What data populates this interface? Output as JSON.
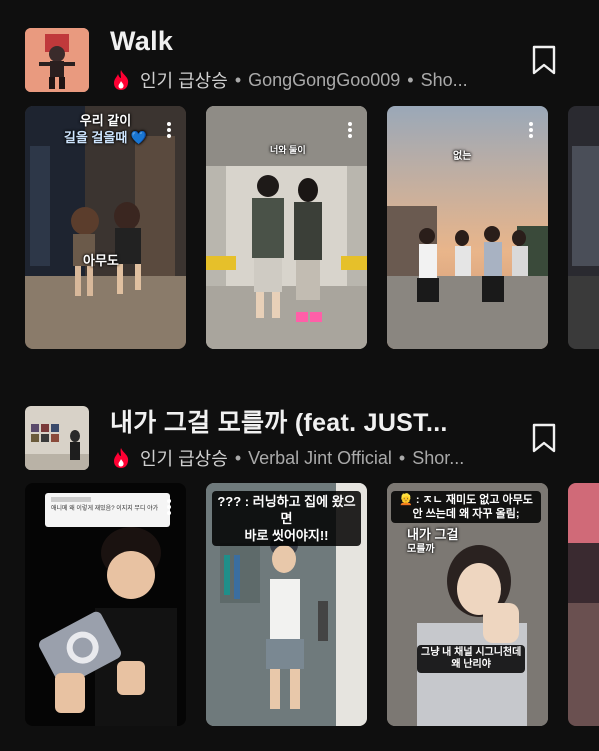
{
  "sections": [
    {
      "title": "Walk",
      "meta": {
        "trend_label": "인기 급상승",
        "channel": "GongGongGoo009",
        "more": "Sho..."
      },
      "cards": [
        {
          "caption_line1": "우리 같이",
          "caption_line2": "길을 걸을때 💙",
          "caption_bottom": "아무도"
        },
        {
          "caption": "너와 둘이"
        },
        {
          "caption": "없는"
        },
        {
          "caption": ""
        }
      ]
    },
    {
      "title": "내가 그걸 모를까 (feat. JUST...",
      "meta": {
        "trend_label": "인기 급상승",
        "channel": "Verbal Jint Official",
        "more": "Shor..."
      },
      "cards": [
        {
          "caption": "애니메 왜 이렇게 재밌음? 이지지 무디 야가"
        },
        {
          "caption_line1": "??? : 러닝하고 집에 왔으면",
          "caption_line2": "바로 씻어야지!!"
        },
        {
          "caption_line1": "👱 : ㅈㄴ 재미도 없고 아무도",
          "caption_line2": "안 쓰는데 왜 자꾸 올림;",
          "caption_mid1": "내가 그걸",
          "caption_mid2": "모를까",
          "caption_bottom1": "그냥 내 채널 시그니천데",
          "caption_bottom2": "왜 난리야"
        },
        {
          "caption": ""
        }
      ]
    }
  ],
  "icons": {
    "trend": "trending-flame-icon",
    "bookmark": "bookmark-icon",
    "more": "more-vertical-icon"
  },
  "colors": {
    "background": "#0f0f0f",
    "trend_red": "#ff0033",
    "text_primary": "#f1f1f1",
    "text_secondary": "#aaaaaa"
  }
}
